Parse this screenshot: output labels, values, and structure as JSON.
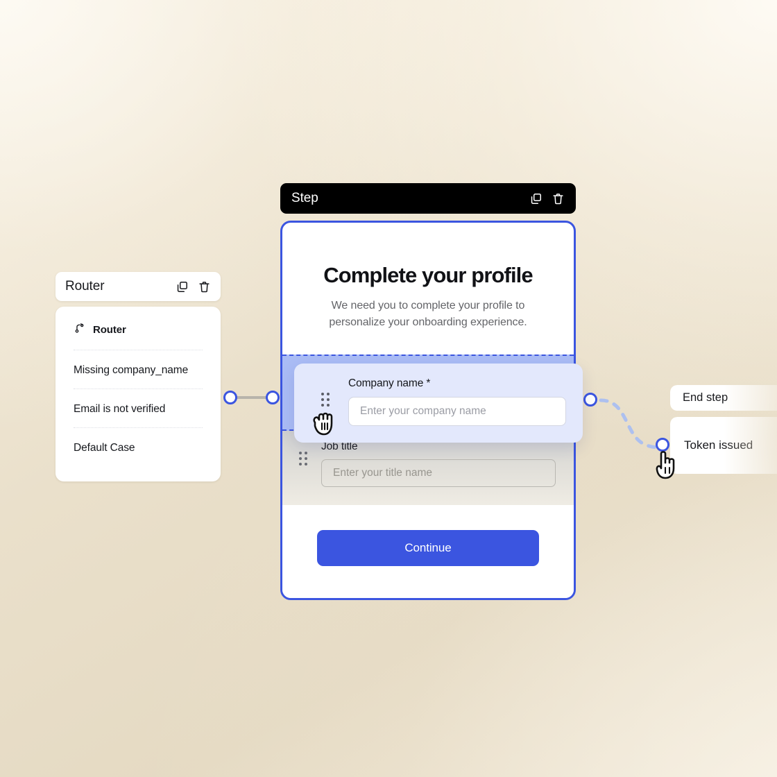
{
  "background": {
    "base_color": "#e5dac3",
    "highlight_color": "#f6efe0"
  },
  "accent_color": "#3b55e0",
  "router_node": {
    "header": {
      "title": "Router",
      "duplicate_icon": "duplicate-icon",
      "delete_icon": "trash-icon"
    },
    "rows": [
      {
        "label": "Router",
        "icon": "git-branch-icon"
      },
      {
        "label": "Missing company_name",
        "icon": ""
      },
      {
        "label": "Email is not verified",
        "icon": ""
      },
      {
        "label": "Default Case",
        "icon": ""
      }
    ]
  },
  "step_node": {
    "header": {
      "title": "Step",
      "duplicate_icon": "duplicate-icon",
      "delete_icon": "trash-icon"
    },
    "content": {
      "heading": "Complete your profile",
      "subheading": "We need you to complete your profile to personalize your onboarding experience.",
      "fields": [
        {
          "label": "Job title",
          "placeholder": "Enter your title name",
          "value": ""
        }
      ],
      "submit_label": "Continue"
    }
  },
  "dragged_field": {
    "label": "Company name *",
    "placeholder": "Enter your company name",
    "value": "",
    "grip_icon": "drag-handle-icon"
  },
  "right_nodes": [
    {
      "label": "End step"
    },
    {
      "label": "Token issued"
    }
  ],
  "cursors": [
    {
      "name": "grabbing-hand-cursor",
      "state": "grabbing"
    },
    {
      "name": "pointing-hand-cursor",
      "state": "pointing"
    }
  ]
}
